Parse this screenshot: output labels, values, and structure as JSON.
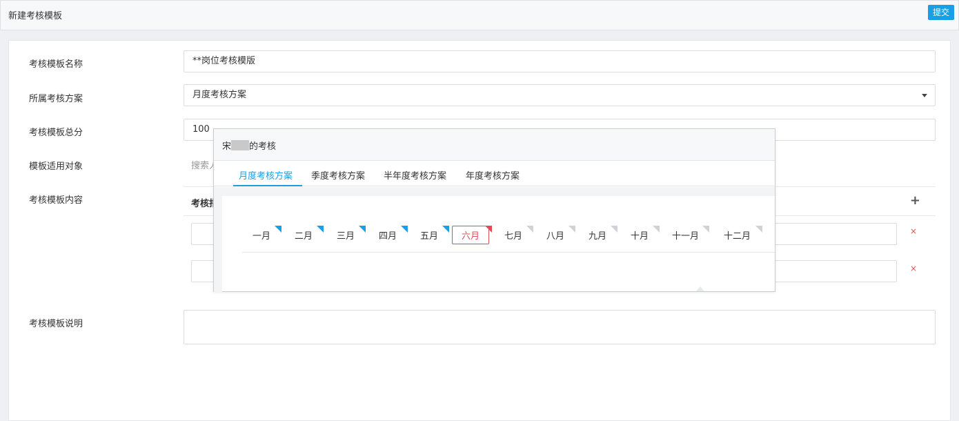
{
  "header": {
    "title": "新建考核模板",
    "submit_label": "提交"
  },
  "form": {
    "name": {
      "label": "考核模板名称",
      "value": "**岗位考核模版"
    },
    "plan": {
      "label": "所属考核方案",
      "value": "月度考核方案"
    },
    "total": {
      "label": "考核模板总分",
      "value": "100"
    },
    "target": {
      "label": "模板适用对象",
      "placeholder": "搜索人"
    },
    "content": {
      "label": "考核模板内容",
      "column_header": "考核指"
    },
    "description": {
      "label": "考核模板说明",
      "value": ""
    }
  },
  "popup": {
    "title_prefix": "宋",
    "title_suffix": "的考核",
    "tabs": [
      {
        "label": "月度考核方案",
        "active": true
      },
      {
        "label": "季度考核方案",
        "active": false
      },
      {
        "label": "半年度考核方案",
        "active": false
      },
      {
        "label": "年度考核方案",
        "active": false
      }
    ],
    "months": [
      {
        "label": "一月",
        "status": "done"
      },
      {
        "label": "二月",
        "status": "done"
      },
      {
        "label": "三月",
        "status": "done"
      },
      {
        "label": "四月",
        "status": "done"
      },
      {
        "label": "五月",
        "status": "done"
      },
      {
        "label": "六月",
        "status": "current"
      },
      {
        "label": "七月",
        "status": "pending"
      },
      {
        "label": "八月",
        "status": "pending"
      },
      {
        "label": "九月",
        "status": "pending"
      },
      {
        "label": "十月",
        "status": "pending"
      },
      {
        "label": "十一月",
        "status": "pending"
      },
      {
        "label": "十二月",
        "status": "pending"
      }
    ]
  },
  "colors": {
    "accent": "#1a9fe6",
    "current": "#e04b5a",
    "pending": "#cfd2d6"
  },
  "icons": {
    "add": "plus-icon",
    "remove": "close-icon",
    "dropdown": "caret-down-icon"
  }
}
